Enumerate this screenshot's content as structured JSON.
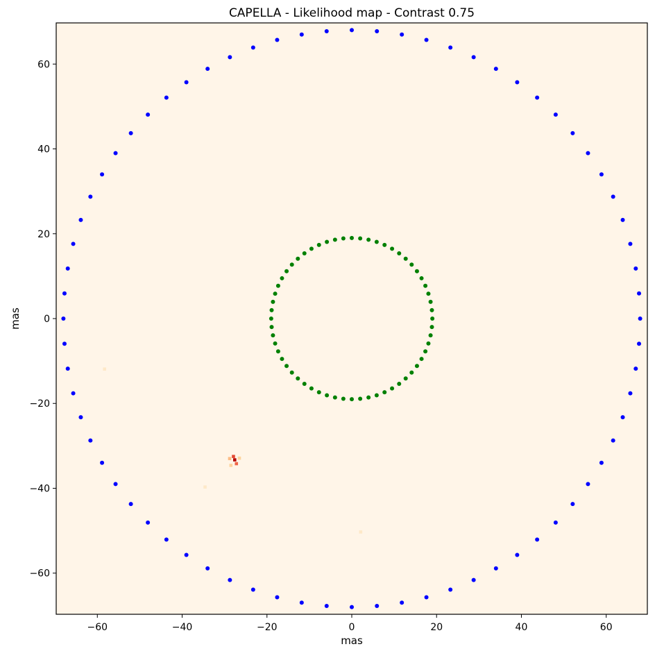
{
  "chart_data": {
    "type": "heatmap",
    "title": "CAPELLA - Likelihood map - Contrast 0.75",
    "xlabel": "mas",
    "ylabel": "mas",
    "xlim": [
      -69.7,
      69.7
    ],
    "ylim": [
      -69.7,
      69.7
    ],
    "x_ticks": [
      -60,
      -40,
      -20,
      0,
      20,
      40,
      60
    ],
    "y_ticks": [
      -60,
      -40,
      -20,
      0,
      20,
      40,
      60
    ],
    "grid": false,
    "background_color": "#fff5e8",
    "colormap": "OrRd",
    "hotspots": [
      {
        "x": -27.6,
        "y": -33.3,
        "value": 1.0,
        "color": "#b30000"
      },
      {
        "x": -27.9,
        "y": -32.5,
        "value": 0.7,
        "color": "#e34a33"
      },
      {
        "x": -27.2,
        "y": -34.2,
        "value": 0.5,
        "color": "#ef6548"
      },
      {
        "x": -28.8,
        "y": -33.0,
        "value": 0.25,
        "color": "#fdbb84"
      },
      {
        "x": -26.5,
        "y": -32.9,
        "value": 0.2,
        "color": "#fdd49e"
      },
      {
        "x": -28.5,
        "y": -34.6,
        "value": 0.15,
        "color": "#fdd49e"
      },
      {
        "x": -58.3,
        "y": -11.9,
        "value": 0.05,
        "color": "#fee8c8"
      },
      {
        "x": -34.6,
        "y": -39.7,
        "value": 0.05,
        "color": "#fee8c8"
      },
      {
        "x": 2.1,
        "y": -50.3,
        "value": 0.04,
        "color": "#fee8c8"
      }
    ],
    "series": [
      {
        "marker": "circle",
        "color": "#0000ff",
        "center": [
          0,
          0
        ],
        "radius": 68,
        "n_points": 72,
        "phase_deg": 0
      },
      {
        "marker": "circle",
        "color": "#008000",
        "center": [
          0,
          0
        ],
        "radius": 19,
        "n_points": 60,
        "phase_deg": 0
      }
    ]
  }
}
